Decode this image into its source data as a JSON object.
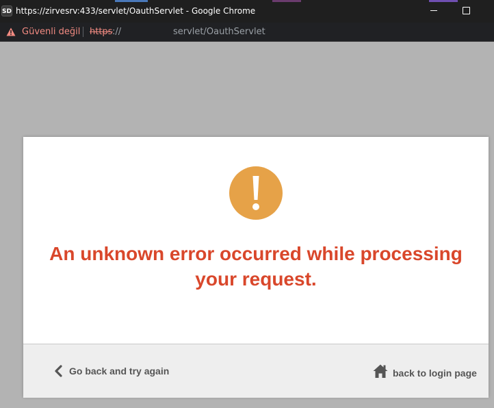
{
  "browser": {
    "app_icon_label": "SD",
    "window_title": "https://zirvesrv:433/servlet/OauthServlet - Google Chrome",
    "security_label": "Güvenli değil",
    "url_scheme": "https",
    "url_separator": "://",
    "url_path": "servlet/OauthServlet",
    "warning_color": "#f28b82"
  },
  "dialog": {
    "icon": "exclamation-circle-icon",
    "icon_color": "#e6a248",
    "message": "An unknown error occurred while processing your request.",
    "message_color": "#d9472b",
    "back_label": "Go back and try again",
    "login_label": "back to login page"
  }
}
